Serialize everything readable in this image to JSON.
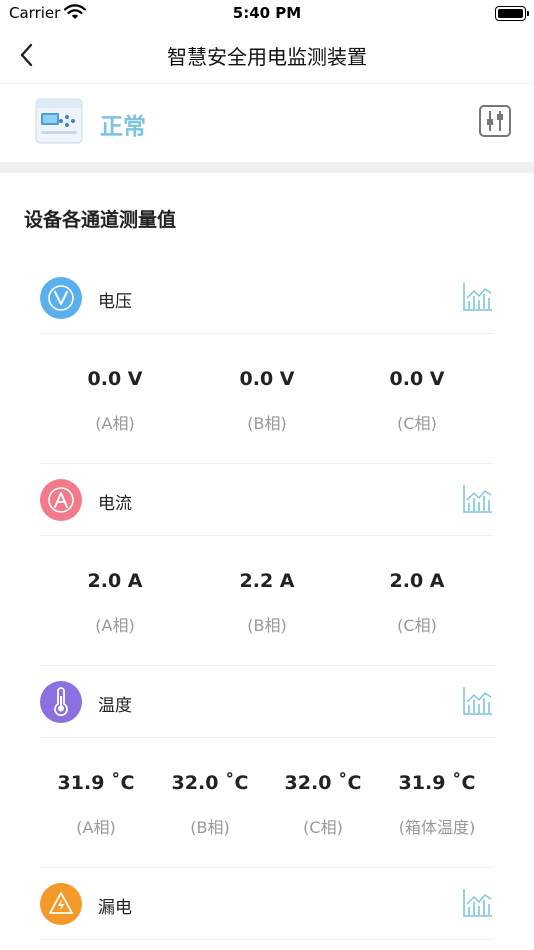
{
  "status_bar": {
    "carrier": "Carrier",
    "time": "5:40 PM"
  },
  "nav": {
    "title": "智慧安全用电监测装置"
  },
  "device": {
    "status": "正常"
  },
  "section": {
    "title": "设备各通道测量值"
  },
  "groups": {
    "voltage": {
      "label": "电压",
      "values": [
        "0.0 V",
        "0.0 V",
        "0.0 V"
      ],
      "phases": [
        "(A相)",
        "(B相)",
        "(C相)"
      ]
    },
    "current": {
      "label": "电流",
      "values": [
        "2.0 A",
        "2.2 A",
        "2.0 A"
      ],
      "phases": [
        "(A相)",
        "(B相)",
        "(C相)"
      ]
    },
    "temperature": {
      "label": "温度",
      "values": [
        "31.9 ˚C",
        "32.0 ˚C",
        "32.0 ˚C",
        "31.9 ˚C"
      ],
      "phases": [
        "(A相)",
        "(B相)",
        "(C相)",
        "(箱体温度)"
      ]
    },
    "leakage": {
      "label": "漏电"
    }
  },
  "colors": {
    "status_text": "#7ac4e0",
    "voltage_icon": "#5ab0ee",
    "current_icon": "#f27a8a",
    "temperature_icon": "#8c6fe0",
    "leakage_icon": "#f49a2a",
    "chart_icon": "#7ac4e0"
  },
  "icons": {
    "back": "chevron-left-icon",
    "device": "power-meter-device-icon",
    "settings": "sliders-icon",
    "voltage": "voltage-icon",
    "current": "current-icon",
    "temperature": "thermometer-icon",
    "leakage": "lightning-warning-icon",
    "chart": "bar-chart-icon"
  }
}
